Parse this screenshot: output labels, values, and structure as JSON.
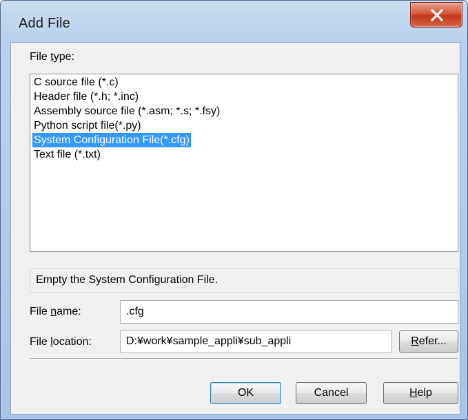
{
  "window": {
    "title": "Add File",
    "close_icon": "close-x-icon"
  },
  "file_type": {
    "label_before": "File ",
    "label_accel": "t",
    "label_after": "ype:",
    "items": [
      "C source file (*.c)",
      "Header file (*.h; *.inc)",
      "Assembly source file (*.asm; *.s; *.fsy)",
      "Python script file(*.py)",
      "System Configuration File(*.cfg)",
      "Text file (*.txt)"
    ],
    "selected_index": 4
  },
  "description": "Empty the System Configuration File.",
  "file_name": {
    "label_before": "File ",
    "label_accel": "n",
    "label_after": "ame:",
    "value": ".cfg"
  },
  "file_location": {
    "label_before": "File ",
    "label_accel": "l",
    "label_after": "ocation:",
    "value": "D:¥work¥sample_appli¥sub_appli",
    "refer_accel": "R",
    "refer_rest": "efer..."
  },
  "buttons": {
    "ok": "OK",
    "cancel": "Cancel",
    "help_accel": "H",
    "help_rest": "elp"
  },
  "colors": {
    "selection": "#3399ff",
    "close_button": "#c4361a"
  }
}
